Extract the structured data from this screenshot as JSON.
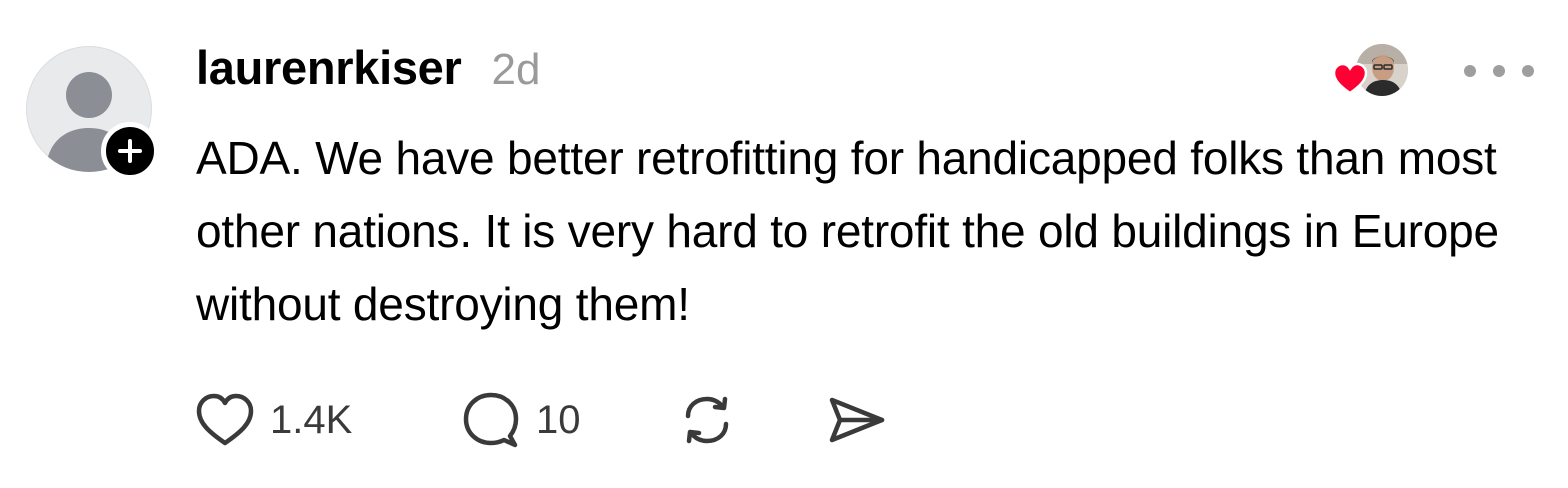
{
  "post": {
    "author": {
      "username": "laurenrkiser",
      "avatar_icon": "default-person-icon",
      "follow_icon": "plus-icon"
    },
    "timestamp": "2d",
    "liked_by": {
      "icon": "heart-icon",
      "heart_color": "#ff0034"
    },
    "more_icon": "ellipsis-icon",
    "text": "ADA. We have better retrofitting for handicapped folks than most other nations. It is very hard to retrofit the old buildings in Europe without destroying them!",
    "actions": {
      "like": {
        "icon": "heart-outline-icon",
        "count": "1.4K"
      },
      "reply": {
        "icon": "comment-icon",
        "count": "10"
      },
      "repost": {
        "icon": "repost-icon"
      },
      "share": {
        "icon": "send-icon"
      }
    }
  }
}
